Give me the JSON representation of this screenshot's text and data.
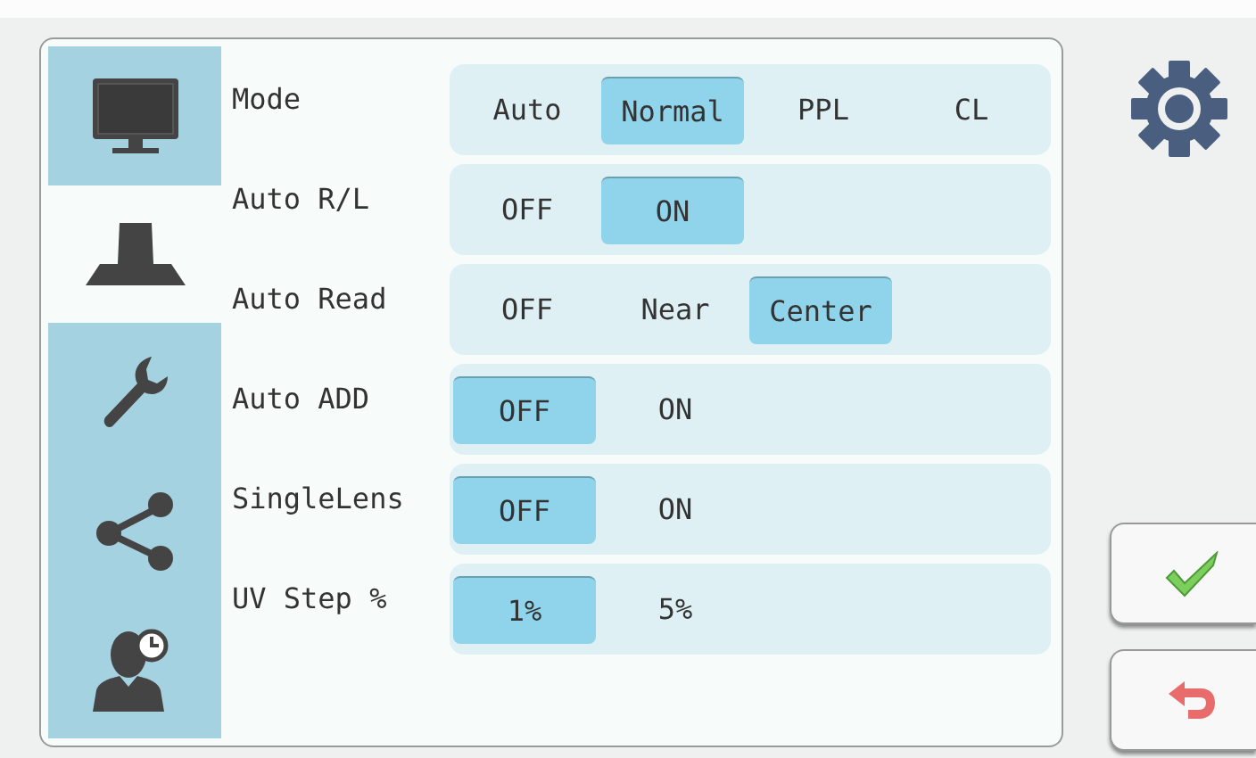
{
  "sidebar": {
    "tabs": [
      {
        "kind": "monitor",
        "selected": false
      },
      {
        "kind": "lamp",
        "selected": true
      },
      {
        "kind": "wrench",
        "selected": false
      },
      {
        "kind": "share",
        "selected": false
      },
      {
        "kind": "user-clock",
        "selected": false
      }
    ]
  },
  "settings": [
    {
      "label": "Mode",
      "options": [
        {
          "label": "Auto",
          "selected": false
        },
        {
          "label": "Normal",
          "selected": true
        },
        {
          "label": "PPL",
          "selected": false
        },
        {
          "label": "CL",
          "selected": false
        }
      ]
    },
    {
      "label": "Auto R/L",
      "options": [
        {
          "label": "OFF",
          "selected": false
        },
        {
          "label": "ON",
          "selected": true
        }
      ]
    },
    {
      "label": "Auto Read",
      "options": [
        {
          "label": "OFF",
          "selected": false
        },
        {
          "label": "Near",
          "selected": false
        },
        {
          "label": "Center",
          "selected": true
        }
      ]
    },
    {
      "label": "Auto ADD",
      "options": [
        {
          "label": "OFF",
          "selected": true
        },
        {
          "label": "ON",
          "selected": false
        }
      ]
    },
    {
      "label": "SingleLens",
      "options": [
        {
          "label": "OFF",
          "selected": true
        },
        {
          "label": "ON",
          "selected": false
        }
      ]
    },
    {
      "label": "UV Step %",
      "options": [
        {
          "label": "1%",
          "selected": true
        },
        {
          "label": "5%",
          "selected": false
        }
      ]
    }
  ],
  "actions": [
    {
      "kind": "confirm"
    },
    {
      "kind": "back"
    }
  ]
}
